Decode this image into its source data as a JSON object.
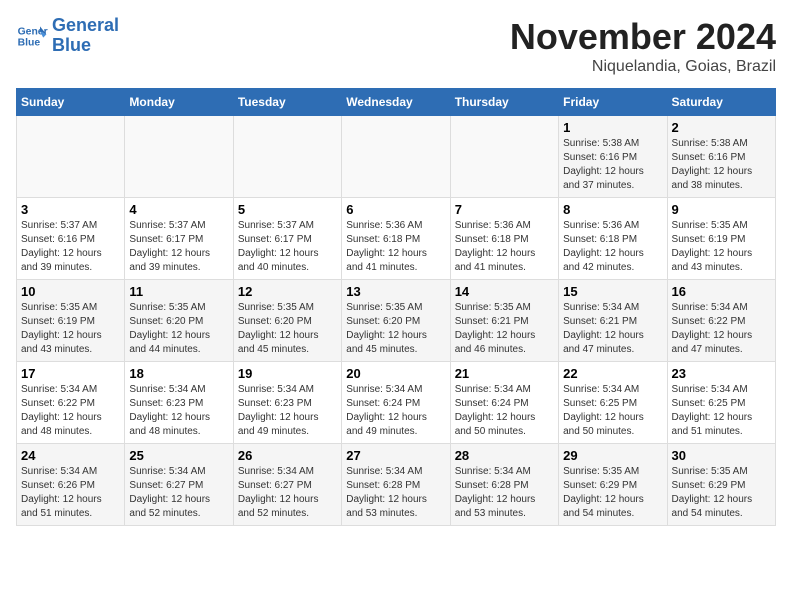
{
  "logo": {
    "line1": "General",
    "line2": "Blue"
  },
  "title": "November 2024",
  "subtitle": "Niquelandia, Goias, Brazil",
  "weekdays": [
    "Sunday",
    "Monday",
    "Tuesday",
    "Wednesday",
    "Thursday",
    "Friday",
    "Saturday"
  ],
  "weeks": [
    [
      {
        "day": "",
        "info": ""
      },
      {
        "day": "",
        "info": ""
      },
      {
        "day": "",
        "info": ""
      },
      {
        "day": "",
        "info": ""
      },
      {
        "day": "",
        "info": ""
      },
      {
        "day": "1",
        "info": "Sunrise: 5:38 AM\nSunset: 6:16 PM\nDaylight: 12 hours\nand 37 minutes."
      },
      {
        "day": "2",
        "info": "Sunrise: 5:38 AM\nSunset: 6:16 PM\nDaylight: 12 hours\nand 38 minutes."
      }
    ],
    [
      {
        "day": "3",
        "info": "Sunrise: 5:37 AM\nSunset: 6:16 PM\nDaylight: 12 hours\nand 39 minutes."
      },
      {
        "day": "4",
        "info": "Sunrise: 5:37 AM\nSunset: 6:17 PM\nDaylight: 12 hours\nand 39 minutes."
      },
      {
        "day": "5",
        "info": "Sunrise: 5:37 AM\nSunset: 6:17 PM\nDaylight: 12 hours\nand 40 minutes."
      },
      {
        "day": "6",
        "info": "Sunrise: 5:36 AM\nSunset: 6:18 PM\nDaylight: 12 hours\nand 41 minutes."
      },
      {
        "day": "7",
        "info": "Sunrise: 5:36 AM\nSunset: 6:18 PM\nDaylight: 12 hours\nand 41 minutes."
      },
      {
        "day": "8",
        "info": "Sunrise: 5:36 AM\nSunset: 6:18 PM\nDaylight: 12 hours\nand 42 minutes."
      },
      {
        "day": "9",
        "info": "Sunrise: 5:35 AM\nSunset: 6:19 PM\nDaylight: 12 hours\nand 43 minutes."
      }
    ],
    [
      {
        "day": "10",
        "info": "Sunrise: 5:35 AM\nSunset: 6:19 PM\nDaylight: 12 hours\nand 43 minutes."
      },
      {
        "day": "11",
        "info": "Sunrise: 5:35 AM\nSunset: 6:20 PM\nDaylight: 12 hours\nand 44 minutes."
      },
      {
        "day": "12",
        "info": "Sunrise: 5:35 AM\nSunset: 6:20 PM\nDaylight: 12 hours\nand 45 minutes."
      },
      {
        "day": "13",
        "info": "Sunrise: 5:35 AM\nSunset: 6:20 PM\nDaylight: 12 hours\nand 45 minutes."
      },
      {
        "day": "14",
        "info": "Sunrise: 5:35 AM\nSunset: 6:21 PM\nDaylight: 12 hours\nand 46 minutes."
      },
      {
        "day": "15",
        "info": "Sunrise: 5:34 AM\nSunset: 6:21 PM\nDaylight: 12 hours\nand 47 minutes."
      },
      {
        "day": "16",
        "info": "Sunrise: 5:34 AM\nSunset: 6:22 PM\nDaylight: 12 hours\nand 47 minutes."
      }
    ],
    [
      {
        "day": "17",
        "info": "Sunrise: 5:34 AM\nSunset: 6:22 PM\nDaylight: 12 hours\nand 48 minutes."
      },
      {
        "day": "18",
        "info": "Sunrise: 5:34 AM\nSunset: 6:23 PM\nDaylight: 12 hours\nand 48 minutes."
      },
      {
        "day": "19",
        "info": "Sunrise: 5:34 AM\nSunset: 6:23 PM\nDaylight: 12 hours\nand 49 minutes."
      },
      {
        "day": "20",
        "info": "Sunrise: 5:34 AM\nSunset: 6:24 PM\nDaylight: 12 hours\nand 49 minutes."
      },
      {
        "day": "21",
        "info": "Sunrise: 5:34 AM\nSunset: 6:24 PM\nDaylight: 12 hours\nand 50 minutes."
      },
      {
        "day": "22",
        "info": "Sunrise: 5:34 AM\nSunset: 6:25 PM\nDaylight: 12 hours\nand 50 minutes."
      },
      {
        "day": "23",
        "info": "Sunrise: 5:34 AM\nSunset: 6:25 PM\nDaylight: 12 hours\nand 51 minutes."
      }
    ],
    [
      {
        "day": "24",
        "info": "Sunrise: 5:34 AM\nSunset: 6:26 PM\nDaylight: 12 hours\nand 51 minutes."
      },
      {
        "day": "25",
        "info": "Sunrise: 5:34 AM\nSunset: 6:27 PM\nDaylight: 12 hours\nand 52 minutes."
      },
      {
        "day": "26",
        "info": "Sunrise: 5:34 AM\nSunset: 6:27 PM\nDaylight: 12 hours\nand 52 minutes."
      },
      {
        "day": "27",
        "info": "Sunrise: 5:34 AM\nSunset: 6:28 PM\nDaylight: 12 hours\nand 53 minutes."
      },
      {
        "day": "28",
        "info": "Sunrise: 5:34 AM\nSunset: 6:28 PM\nDaylight: 12 hours\nand 53 minutes."
      },
      {
        "day": "29",
        "info": "Sunrise: 5:35 AM\nSunset: 6:29 PM\nDaylight: 12 hours\nand 54 minutes."
      },
      {
        "day": "30",
        "info": "Sunrise: 5:35 AM\nSunset: 6:29 PM\nDaylight: 12 hours\nand 54 minutes."
      }
    ]
  ]
}
